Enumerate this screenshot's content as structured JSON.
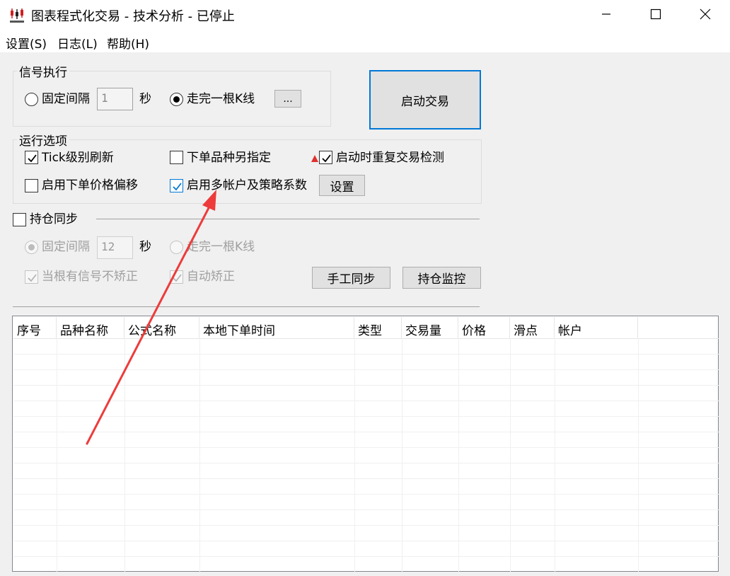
{
  "window": {
    "title": "图表程式化交易 - 技术分析 - 已停止"
  },
  "menu": {
    "items": [
      {
        "label": "设置(S)"
      },
      {
        "label": "日志(L)"
      },
      {
        "label": "帮助(H)"
      }
    ]
  },
  "signal_group": {
    "label": "信号执行",
    "fixed_interval_label": "固定间隔",
    "interval_value": "1",
    "seconds_label": "秒",
    "bar_complete_label": "走完一根K线",
    "more_button_label": "...",
    "selected": "bar_complete"
  },
  "start_button_label": "启动交易",
  "options_group": {
    "label": "运行选项",
    "tick_refresh": {
      "label": "Tick级别刷新",
      "checked": true
    },
    "order_symbol": {
      "label": "下单品种另指定",
      "checked": false
    },
    "repeat_check": {
      "label": "启动时重复交易检测",
      "checked": true
    },
    "price_offset": {
      "label": "启用下单价格偏移",
      "checked": false
    },
    "multi_account": {
      "label": "启用多帐户及策略系数",
      "checked": true
    },
    "settings_button_label": "设置"
  },
  "position_sync": {
    "label": "持仓同步",
    "checked": false,
    "fixed_interval_label": "固定间隔",
    "interval_value": "12",
    "seconds_label": "秒",
    "bar_complete_label": "走完一根K线",
    "no_correct_label": "当根有信号不矫正",
    "auto_correct_label": "自动矫正",
    "manual_sync_button_label": "手工同步",
    "monitor_button_label": "持仓监控"
  },
  "table": {
    "columns": [
      "序号",
      "品种名称",
      "公式名称",
      "本地下单时间",
      "类型",
      "交易量",
      "价格",
      "滑点",
      "帐户"
    ]
  },
  "colors": {
    "accent": "#0078d7",
    "annotation_arrow": "#ee3b3b"
  }
}
